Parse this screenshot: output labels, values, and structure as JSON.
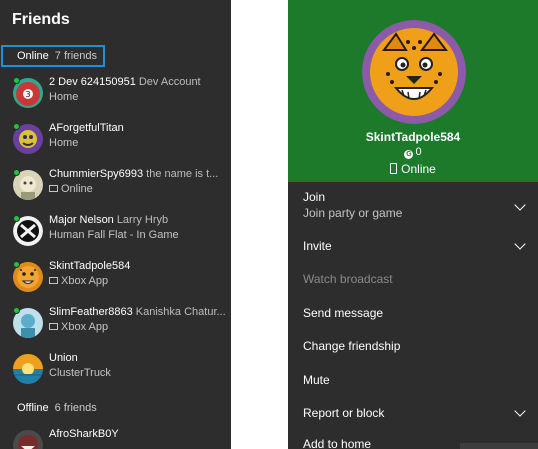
{
  "friends_panel": {
    "title": "Friends",
    "online_label": "Online",
    "online_count": "7 friends",
    "offline_label": "Offline",
    "offline_count": "6 friends",
    "friends": [
      {
        "gamertag": "2 Dev 624150951",
        "real_name": "Dev Account",
        "status": "Home",
        "avatar": "bowling-ball-avatar",
        "platform": ""
      },
      {
        "gamertag": "AForgetfulTitan",
        "real_name": "",
        "status": "Home",
        "avatar": "purple-creature-avatar",
        "platform": ""
      },
      {
        "gamertag": "ChummierSpy6993",
        "real_name": "the name is t...",
        "status": "Online",
        "avatar": "pale-face-avatar",
        "platform": "pc"
      },
      {
        "gamertag": "Major Nelson",
        "real_name": "Larry Hryb",
        "status": "Human Fall Flat - In Game",
        "avatar": "xbox-logo-avatar",
        "platform": ""
      },
      {
        "gamertag": "SkintTadpole584",
        "real_name": "",
        "status": "Xbox App",
        "avatar": "cheetah-avatar",
        "platform": "pc"
      },
      {
        "gamertag": "SlimFeather8863",
        "real_name": "Kanishka Chatur...",
        "status": "Xbox App",
        "avatar": "teal-figure-avatar",
        "platform": "pc"
      },
      {
        "gamertag": "Union",
        "real_name": "",
        "status": "ClusterTruck",
        "avatar": "sunset-avatar",
        "platform": ""
      },
      {
        "gamertag": "AfroSharkB0Y",
        "real_name": "",
        "status": "",
        "avatar": "shark-avatar",
        "platform": ""
      }
    ]
  },
  "profile_panel": {
    "gamertag": "SkintTadpole584",
    "gamerscore": "0",
    "gamerscore_icon": "G",
    "status": "Online",
    "hero_color": "#1d7a2b",
    "menu": [
      {
        "label": "Join",
        "sub": "Join party or game",
        "chevron": true,
        "disabled": false
      },
      {
        "label": "Invite",
        "sub": "",
        "chevron": true,
        "disabled": false
      },
      {
        "label": "Watch broadcast",
        "sub": "",
        "chevron": false,
        "disabled": true
      },
      {
        "label": "Send message",
        "sub": "",
        "chevron": false,
        "disabled": false
      },
      {
        "label": "Change friendship",
        "sub": "",
        "chevron": false,
        "disabled": false
      },
      {
        "label": "Mute",
        "sub": "",
        "chevron": false,
        "disabled": false
      },
      {
        "label": "Report or block",
        "sub": "",
        "chevron": true,
        "disabled": false
      },
      {
        "label": "Add to home",
        "sub": "",
        "chevron": false,
        "disabled": false
      }
    ]
  },
  "colors": {
    "panel_bg": "#2d2d2d",
    "accent": "#1e90d6",
    "online_dot": "#18c838"
  }
}
